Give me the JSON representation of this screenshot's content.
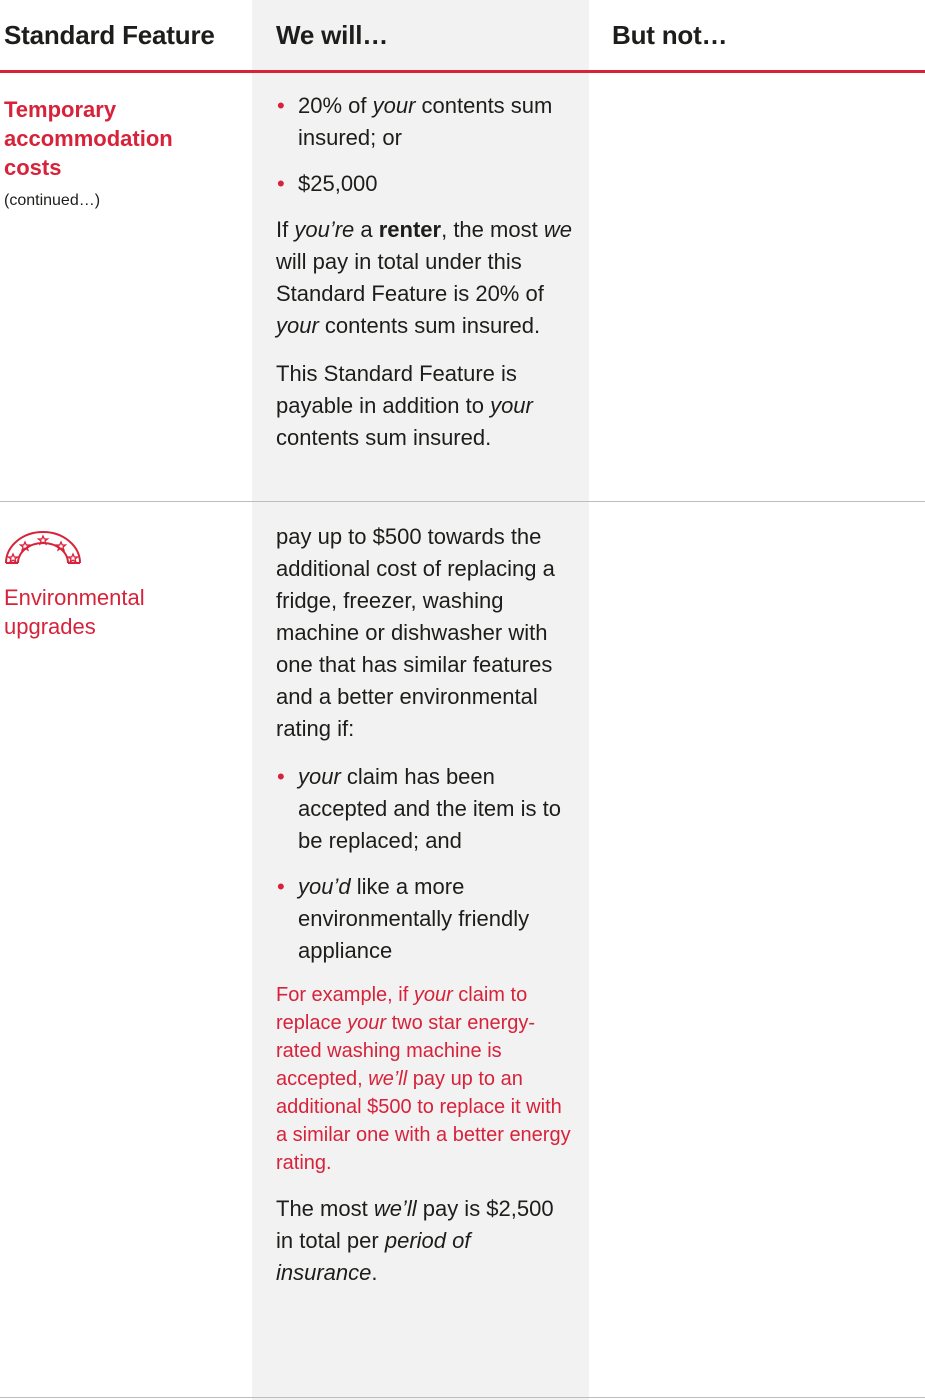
{
  "header": {
    "col1": "Standard Feature",
    "col2": "We will…",
    "col3": "But not…"
  },
  "row1": {
    "title": "Temporary accommodation costs",
    "note": "(continued…)",
    "bullets": [
      [
        "20% of ",
        "your",
        " contents sum insured; or"
      ],
      [
        "$25,000"
      ]
    ],
    "para1": {
      "a": "If ",
      "b": "you’re",
      "c": " a ",
      "d": "renter",
      "e": ", the most ",
      "f": "we",
      "g": " will pay in total under this Standard Feature is 20% of ",
      "h": "your",
      "i": " contents sum insured."
    },
    "para2": {
      "a": "This Standard Feature is payable in addition to ",
      "b": "your",
      "c": " contents sum insured."
    }
  },
  "row2": {
    "title": "Environmental upgrades",
    "icon": "energy-rating-stars-icon",
    "intro": "pay up to $500 towards the additional cost of replacing a fridge, freezer, washing machine or dishwasher with one that has similar features and a better environmental rating if:",
    "bullets": [
      [
        "your",
        " claim has been accepted and the item is to be replaced; and"
      ],
      [
        "you’d",
        " like a more environmentally friendly appliance"
      ]
    ],
    "example": {
      "a": "For example, if ",
      "b": "your",
      "c": " claim to replace ",
      "d": "your",
      "e": " two star energy-rated washing machine is accepted, ",
      "f": "we’ll",
      "g": " pay up to an additional $500 to replace it with a similar one with a better energy rating."
    },
    "limit": {
      "a": "The most ",
      "b": "we’ll",
      "c": " pay is $2,500 in total per ",
      "d": "period of insurance",
      "e": "."
    }
  },
  "colors": {
    "accent": "#d7223a",
    "text": "#1d1d1b",
    "column_shade": "#f2f2f2"
  }
}
